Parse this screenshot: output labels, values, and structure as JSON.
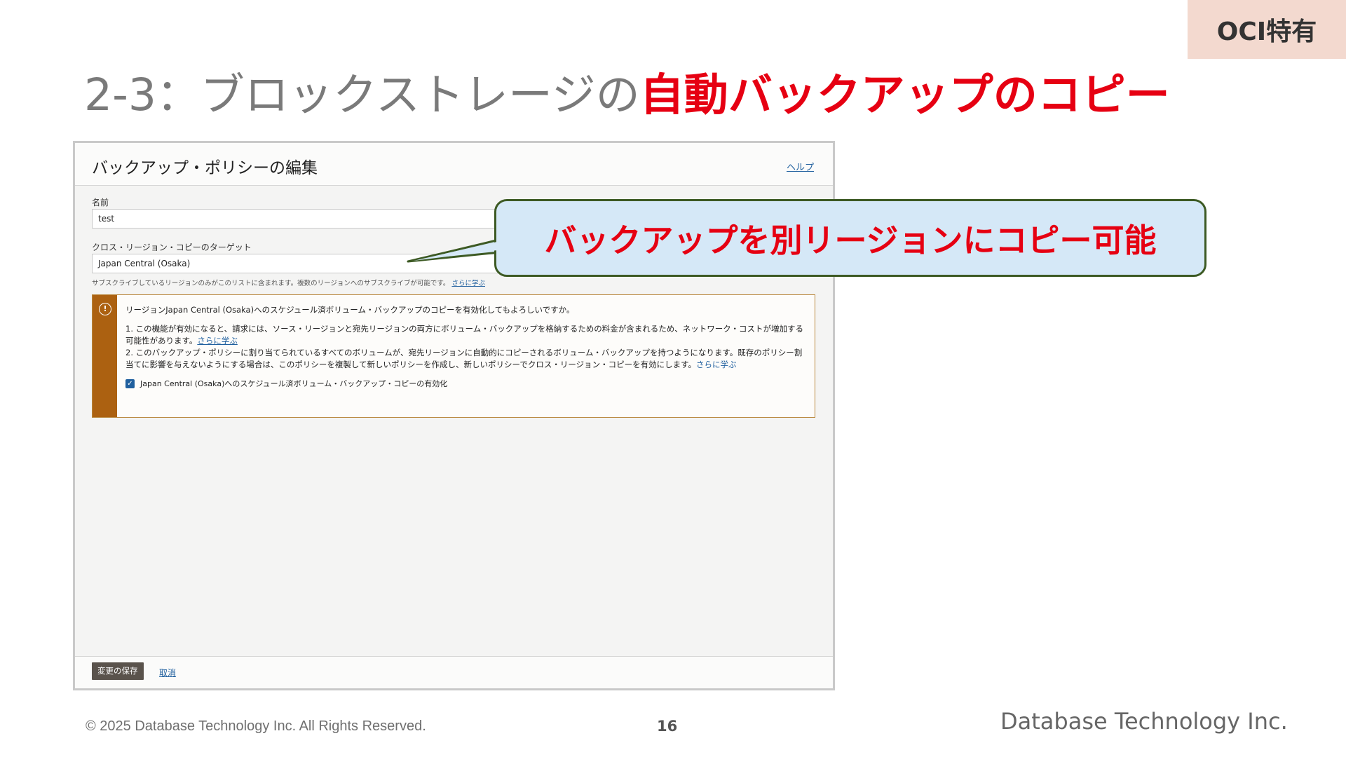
{
  "tag": "OCI特有",
  "title": {
    "prefix": "2-3：ブロックストレージの",
    "highlight": "自動バックアップのコピー"
  },
  "dialog": {
    "title": "バックアップ・ポリシーの編集",
    "help_link": "ヘルプ",
    "name_label": "名前",
    "name_value": "test",
    "target_label": "クロス・リージョン・コピーのターゲット",
    "target_value": "Japan Central (Osaka)",
    "help_text": "サブスクライブしているリージョンのみがこのリストに含まれます。複数のリージョンへのサブスクライブが可能です。",
    "help_text_link": "さらに学ぶ",
    "alert": {
      "icon": "!",
      "headline": "リージョンJapan Central (Osaka)へのスケジュール済ボリューム・バックアップのコピーを有効化してもよろしいですか。",
      "item1": "1. この機能が有効になると、請求には、ソース・リージョンと宛先リージョンの両方にボリューム・バックアップを格納するための料金が含まれるため、ネットワーク・コストが増加する可能性があります。",
      "item1_link": "さらに学ぶ",
      "item2": "2. このバックアップ・ポリシーに割り当てられているすべてのボリュームが、宛先リージョンに自動的にコピーされるボリューム・バックアップを持つようになります。既存のポリシー割当てに影響を与えないようにする場合は、このポリシーを複製して新しいポリシーを作成し、新しいポリシーでクロス・リージョン・コピーを有効にします。",
      "item2_link": "さらに学ぶ",
      "checkbox_label": "Japan Central (Osaka)へのスケジュール済ボリューム・バックアップ・コピーの有効化"
    },
    "save_button": "変更の保存",
    "cancel_link": "取消"
  },
  "callout": "バックアップを別リージョンにコピー可能",
  "footer": {
    "copyright": "© 2025 Database Technology Inc. All Rights Reserved.",
    "page": "16",
    "company": "Database Technology Inc."
  },
  "colors": {
    "accent_red": "#e60012",
    "tag_bg": "#f3d9cf",
    "callout_bg": "#d5e8f7",
    "alert_bar": "#ac6111",
    "link_blue": "#1f5f9e"
  }
}
